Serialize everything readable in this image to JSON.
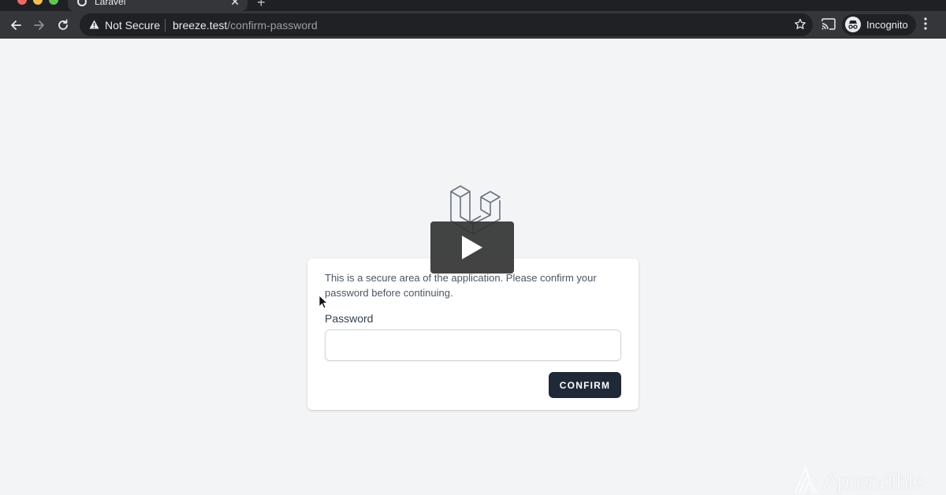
{
  "browser": {
    "tab": {
      "title": "Laravel",
      "close_glyph": "✕"
    },
    "new_tab_glyph": "+",
    "security_label": "Not Secure",
    "url": {
      "host": "breeze.test",
      "path": "/confirm-password"
    },
    "profile_label": "Incognito"
  },
  "icons": {
    "back": "arrow-left-icon",
    "forward": "arrow-right-icon",
    "reload": "reload-icon",
    "warning": "warning-icon",
    "star": "star-icon",
    "cast": "cast-icon",
    "incognito": "incognito-icon",
    "menu": "kebab-menu-icon",
    "logo": "laravel-logo-icon",
    "play": "play-icon",
    "cursor": "mouse-cursor-icon"
  },
  "page": {
    "message": "This is a secure area of the application. Please confirm your password before continuing.",
    "password_label": "Password",
    "password_value": "",
    "confirm_label": "CONFIRM"
  },
  "watermark": {
    "text": "Aprendible"
  },
  "colors": {
    "chrome_dark": "#35363a",
    "page_bg": "#f3f4f6",
    "button_bg": "#1f2937"
  }
}
